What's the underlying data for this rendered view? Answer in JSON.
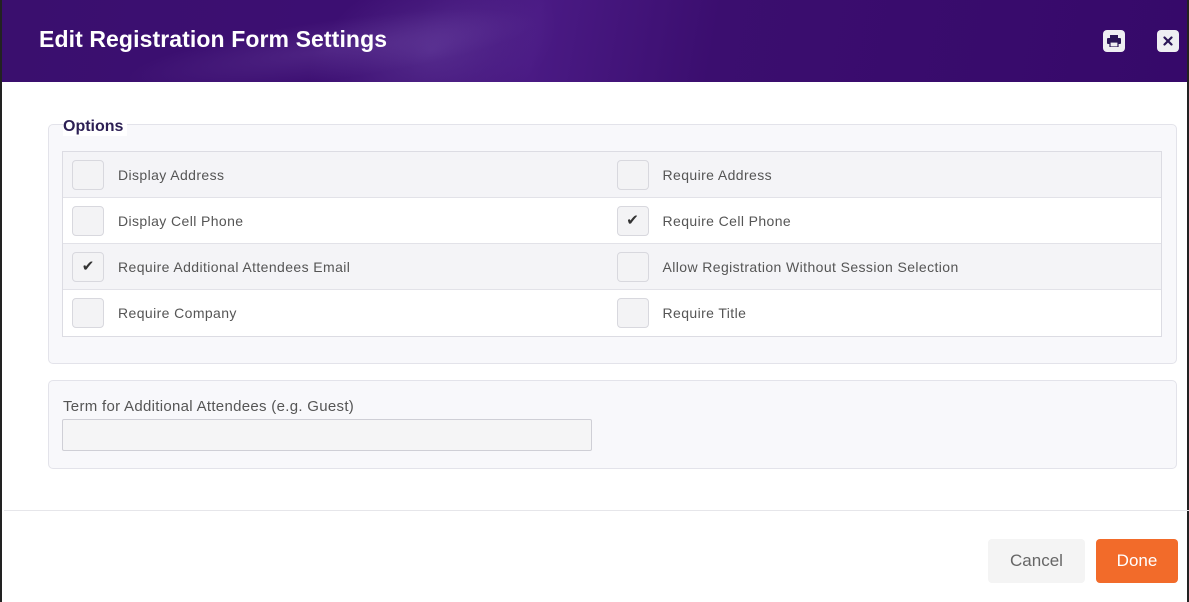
{
  "dialog": {
    "title": "Edit Registration Form Settings",
    "header_color": "#3a0f6e",
    "icons": {
      "print": "print-icon",
      "close": "close-icon"
    }
  },
  "options": {
    "legend": "Options",
    "rows": [
      {
        "left": {
          "label": "Display Address",
          "checked": false
        },
        "right": {
          "label": "Require Address",
          "checked": false
        }
      },
      {
        "left": {
          "label": "Display Cell Phone",
          "checked": false
        },
        "right": {
          "label": "Require Cell Phone",
          "checked": true
        }
      },
      {
        "left": {
          "label": "Require Additional Attendees Email",
          "checked": true
        },
        "right": {
          "label": "Allow Registration Without Session Selection",
          "checked": false
        }
      },
      {
        "left": {
          "label": "Require Company",
          "checked": false
        },
        "right": {
          "label": "Require Title",
          "checked": false
        }
      }
    ],
    "check_glyph": "✔"
  },
  "term": {
    "label": "Term for Additional Attendees (e.g. Guest)",
    "value": "",
    "placeholder": ""
  },
  "footer": {
    "cancel_label": "Cancel",
    "done_label": "Done",
    "done_color": "#f26b2a"
  }
}
